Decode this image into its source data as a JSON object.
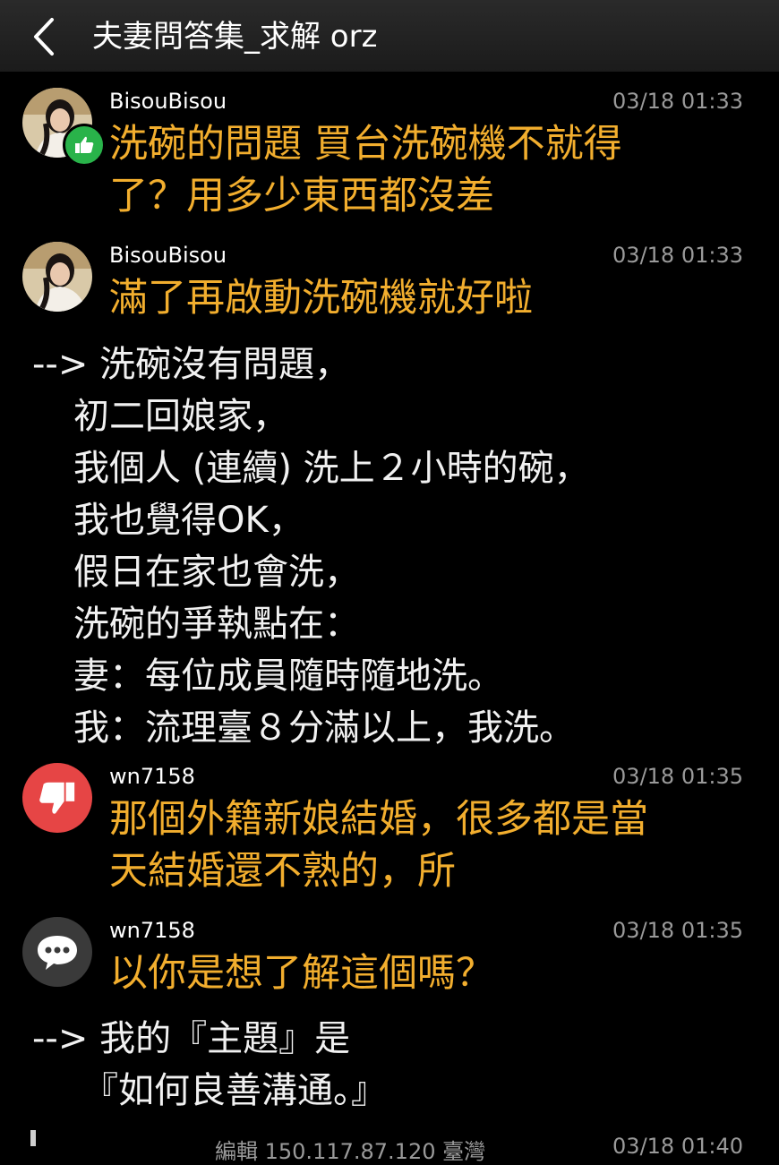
{
  "header": {
    "title": "夫妻問答集_求解 orz",
    "back_icon": "chevron-left-icon"
  },
  "posts": [
    {
      "user": "BisouBisou",
      "time": "03/18 01:33",
      "icon": "thumbs-up-icon",
      "lines": [
        "洗碗的問題 買台洗碗機不就得",
        "了？用多少東西都沒差"
      ]
    },
    {
      "user": "BisouBisou",
      "time": "03/18 01:33",
      "lines": [
        "滿了再啟動洗碗機就好啦"
      ]
    },
    {
      "user": "wn7158",
      "time": "03/18 01:35",
      "icon": "thumbs-down-icon",
      "lines": [
        "那個外籍新娘結婚，很多都是當",
        "天結婚還不熟的，所"
      ]
    },
    {
      "user": "wn7158",
      "time": "03/18 01:35",
      "icon": "comment-icon",
      "lines": [
        "以你是想了解這個嗎？"
      ]
    }
  ],
  "replies": [
    {
      "lines": [
        "--> 洗碗沒有問題，",
        "初二回娘家，",
        "我個人 (連續) 洗上２小時的碗，",
        "我也覺得OK，",
        "假日在家也會洗，",
        "洗碗的爭執點在：",
        "妻：每位成員隨時隨地洗。",
        "我：流理臺８分滿以上，我洗。"
      ]
    },
    {
      "lines": [
        "--> 我的『主題』是",
        "『如何良善溝通。』"
      ]
    }
  ],
  "footer": {
    "text": "編輯 150.117.87.120 臺灣",
    "time": "03/18 01:40"
  },
  "colors": {
    "push_text": "#f2ae2e",
    "like_green": "#29b34a",
    "dislike_red": "#e64545"
  }
}
